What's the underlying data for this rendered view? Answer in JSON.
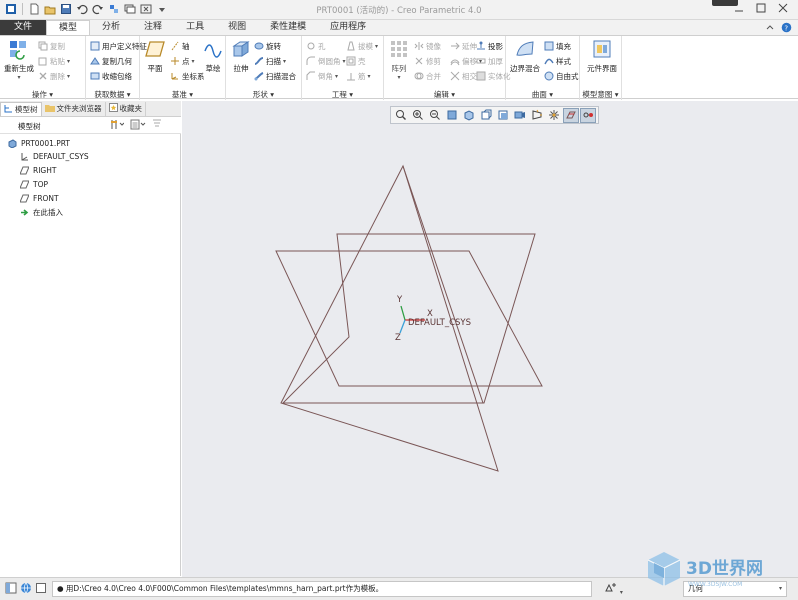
{
  "window": {
    "title": "PRT0001 (活动的) - Creo Parametric 4.0"
  },
  "tabs": [
    {
      "label": "文件"
    },
    {
      "label": "模型"
    },
    {
      "label": "分析"
    },
    {
      "label": "注释"
    },
    {
      "label": "工具"
    },
    {
      "label": "视图"
    },
    {
      "label": "柔性建模"
    },
    {
      "label": "应用程序"
    }
  ],
  "ribbon": {
    "operations": {
      "footer": "操作",
      "regenerate": "重新生成",
      "copy": "复制",
      "paste": "粘贴",
      "delete": "删除"
    },
    "get_data": {
      "footer": "获取数据",
      "udf": "用户定义特征",
      "copy_geom": "复制几何",
      "shrinkwrap": "收缩包络"
    },
    "datum": {
      "footer": "基准",
      "plane": "平面",
      "axis": "轴",
      "point": "点",
      "csys": "坐标系",
      "sketch": "草绘"
    },
    "shapes": {
      "footer": "形状",
      "extrude": "拉伸",
      "revolve": "旋转",
      "sweep": "扫描",
      "swept_blend": "扫描混合"
    },
    "engineering": {
      "footer": "工程",
      "hole": "孔",
      "round": "倒圆角",
      "chamfer": "倒角",
      "draft": "拔模",
      "shell": "壳",
      "rib": "筋"
    },
    "editing": {
      "footer": "编辑",
      "pattern": "阵列",
      "mirror": "镜像",
      "extend": "延伸",
      "project": "投影",
      "trim": "修剪",
      "offset": "偏移",
      "thicken": "加厚",
      "merge": "合并",
      "intersect": "相交",
      "solidify": "实体化"
    },
    "surfaces": {
      "footer": "曲面",
      "boundary_blend": "边界混合",
      "fill": "填充",
      "style": "样式",
      "freestyle": "自由式"
    },
    "model_intent": {
      "footer": "模型意图",
      "component_interface": "元件界面"
    }
  },
  "panel": {
    "tabs": [
      {
        "label": "模型树"
      },
      {
        "label": "文件夹浏览器"
      },
      {
        "label": "收藏夹"
      }
    ],
    "tree_header": "模型树",
    "tree_items": [
      {
        "label": "PRT0001.PRT"
      },
      {
        "label": "DEFAULT_CSYS"
      },
      {
        "label": "RIGHT"
      },
      {
        "label": "TOP"
      },
      {
        "label": "FRONT"
      },
      {
        "label": "在此插入"
      }
    ]
  },
  "graphics": {
    "csys_label": "DEFAULT_CSYS",
    "axis_x": "X",
    "axis_y": "Y",
    "axis_z": "Z",
    "datum_color": "#7a5656"
  },
  "status": {
    "message": "● 用D:\\Creo 4.0\\Creo 4.0\\F000\\Common Files\\templates\\mmns_harn_part.prt作为模板。",
    "filter": "几何"
  },
  "watermark": {
    "logo_text": "3D世界网",
    "url": "WWW.3DSJW.COM"
  },
  "colors": {
    "file_tab": "#3b3b3b",
    "ribbon_bg": "#ffffff",
    "graphics_bg": "#eaebef",
    "accent": "#2a72c7"
  }
}
